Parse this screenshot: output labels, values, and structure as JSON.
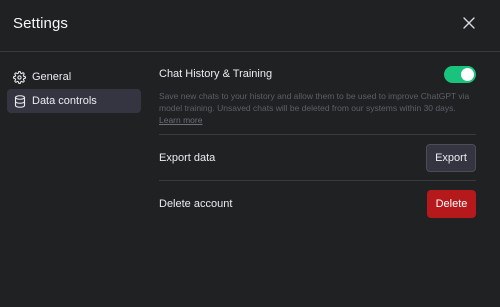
{
  "dialog": {
    "title": "Settings",
    "close_icon": "close-icon"
  },
  "sidebar": {
    "items": [
      {
        "label": "General",
        "icon": "gear-icon",
        "active": false
      },
      {
        "label": "Data controls",
        "icon": "database-icon",
        "active": true
      }
    ]
  },
  "data_controls": {
    "history": {
      "label": "Chat History & Training",
      "enabled": true,
      "description": "Save new chats to your history and allow them to be used to improve ChatGPT via model training. Unsaved chats will be deleted from our systems within 30 days.",
      "learn_more": "Learn more"
    },
    "export": {
      "label": "Export data",
      "button": "Export"
    },
    "delete": {
      "label": "Delete account",
      "button": "Delete"
    }
  },
  "colors": {
    "background": "#202123",
    "accent_toggle": "#19c37d",
    "danger": "#b5191c",
    "active_nav": "#343541"
  }
}
